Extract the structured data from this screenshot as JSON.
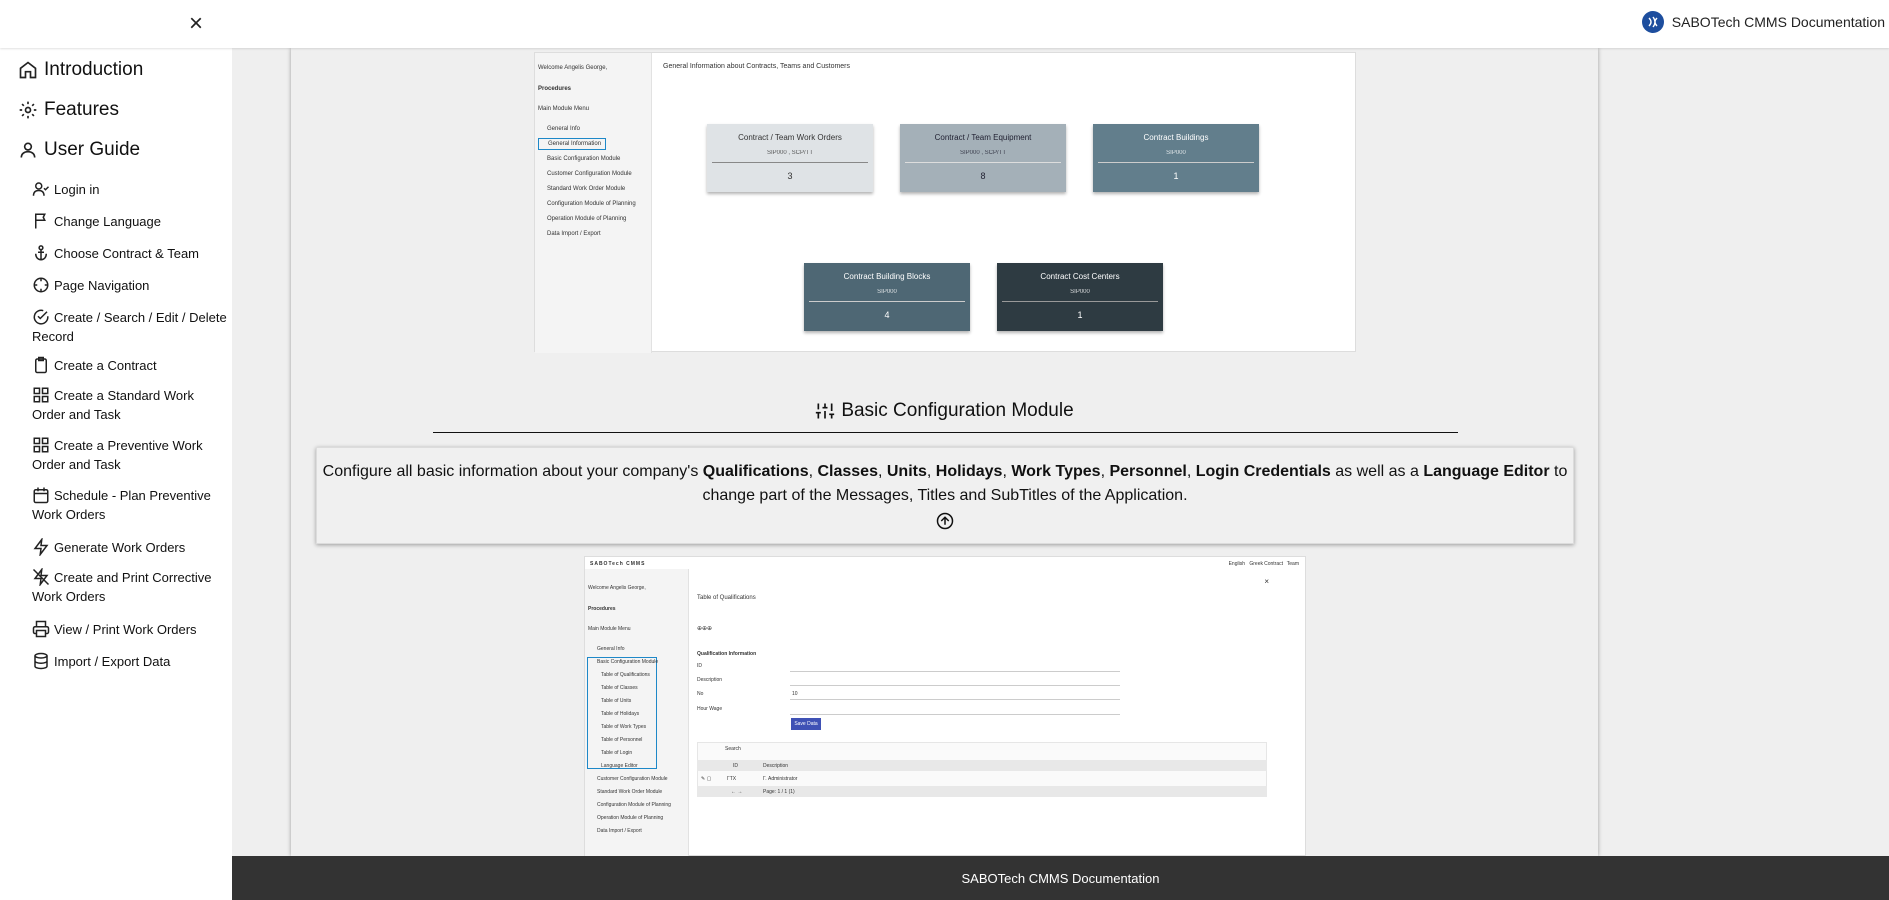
{
  "brand": {
    "title": "SABOTech CMMS Documentation"
  },
  "sidebar": {
    "top": [
      {
        "label": "Introduction",
        "icon": "home-icon"
      },
      {
        "label": "Features",
        "icon": "gear-icon"
      },
      {
        "label": "User Guide",
        "icon": "user-icon"
      }
    ],
    "items": [
      {
        "label": "Login in",
        "icon": "user-check-icon"
      },
      {
        "label": "Change Language",
        "icon": "flag-icon"
      },
      {
        "label": "Choose Contract & Team",
        "icon": "anchor-icon"
      },
      {
        "label": "Page Navigation",
        "icon": "crosshair-icon"
      },
      {
        "label": "Create / Search / Edit / Delete Record",
        "icon": "check-circle-icon"
      },
      {
        "label": "Create a Contract",
        "icon": "clipboard-icon"
      },
      {
        "label": "Create a Standard Work Order and Task",
        "icon": "grid-icon"
      },
      {
        "label": "Create a Preventive Work Order and Task",
        "icon": "grid-icon"
      },
      {
        "label": "Schedule - Plan Preventive Work Orders",
        "icon": "calendar-icon"
      },
      {
        "label": "Generate Work Orders",
        "icon": "zap-icon"
      },
      {
        "label": "Create and Print Corrective Work Orders",
        "icon": "zap-off-icon"
      },
      {
        "label": "View / Print Work Orders",
        "icon": "printer-icon"
      },
      {
        "label": "Import / Export Data",
        "icon": "database-icon"
      }
    ]
  },
  "shot1": {
    "welcome": "Welcome Angelis George,",
    "procedures": "Procedures",
    "menu": "Main Module Menu",
    "links": [
      "General Info",
      "General Information",
      "Basic Configuration Module",
      "Customer Configuration Module",
      "Standard Work Order Module",
      "Configuration Module of Planning",
      "Operation Module of Planning",
      "Data Import / Export"
    ],
    "header": "General Information about Contracts, Teams and Customers",
    "tiles": [
      {
        "title": "Contract / Team Work Orders",
        "sub": "SIP000 , SCP/TT",
        "value": "3"
      },
      {
        "title": "Contract / Team Equipment",
        "sub": "SIP000 , SCP/TT",
        "value": "8"
      },
      {
        "title": "Contract Buildings",
        "sub": "SIP000",
        "value": "1"
      },
      {
        "title": "Contract Building Blocks",
        "sub": "SIP000",
        "value": "4"
      },
      {
        "title": "Contract Cost Centers",
        "sub": "SIP000",
        "value": "1"
      }
    ]
  },
  "section": {
    "title": "Basic Configuration Module",
    "desc_intro": "Configure all basic information about your company's",
    "terms": [
      "Qualifications",
      "Classes",
      "Units",
      "Holidays",
      "Work Types",
      "Personnel",
      "Login Credentials"
    ],
    "desc_mid": "as well as a",
    "term_last": "Language Editor",
    "desc_end": "to change part of the Messages, Titles and SubTitles of the Application."
  },
  "shot2": {
    "logo": "SABOTech CMMS",
    "topbar": [
      "English",
      "Greek",
      "Contract",
      "Team"
    ],
    "welcome": "Welcome Angelis George,",
    "procedures": "Procedures",
    "menu": "Main Module Menu",
    "links": [
      "General Info",
      "Basic Configuration Module",
      "Table of Qualifications",
      "Table of Classes",
      "Table of Units",
      "Table of Holidays",
      "Table of Work Types",
      "Table of Personnel",
      "Table of Login",
      "Language Editor",
      "Customer Configuration Module",
      "Standard Work Order Module",
      "Configuration Module of Planning",
      "Operation Module of Planning",
      "Data Import / Export"
    ],
    "page_title": "Table of Qualifications",
    "form_title": "Qualification Information",
    "fields": [
      "ID",
      "Description",
      "No",
      "Hour Wage"
    ],
    "no_value": "10",
    "save": "Save Data",
    "search": "Search",
    "col_id": "ID",
    "col_desc": "Description",
    "row_id": "ΓΤΧ",
    "row_desc": "Γ. Administrator",
    "pager": "Page: 1 / 1 (1)"
  },
  "footer": {
    "text": "SABOTech CMMS Documentation"
  },
  "colors": {
    "footer_bg": "#333333",
    "tile1": "#dfe3e6",
    "tile2": "#a4b0b8",
    "tile3": "#627e8c",
    "tile4": "#4e6774",
    "tile5": "#2e3b42",
    "accent": "#3f51b5"
  }
}
